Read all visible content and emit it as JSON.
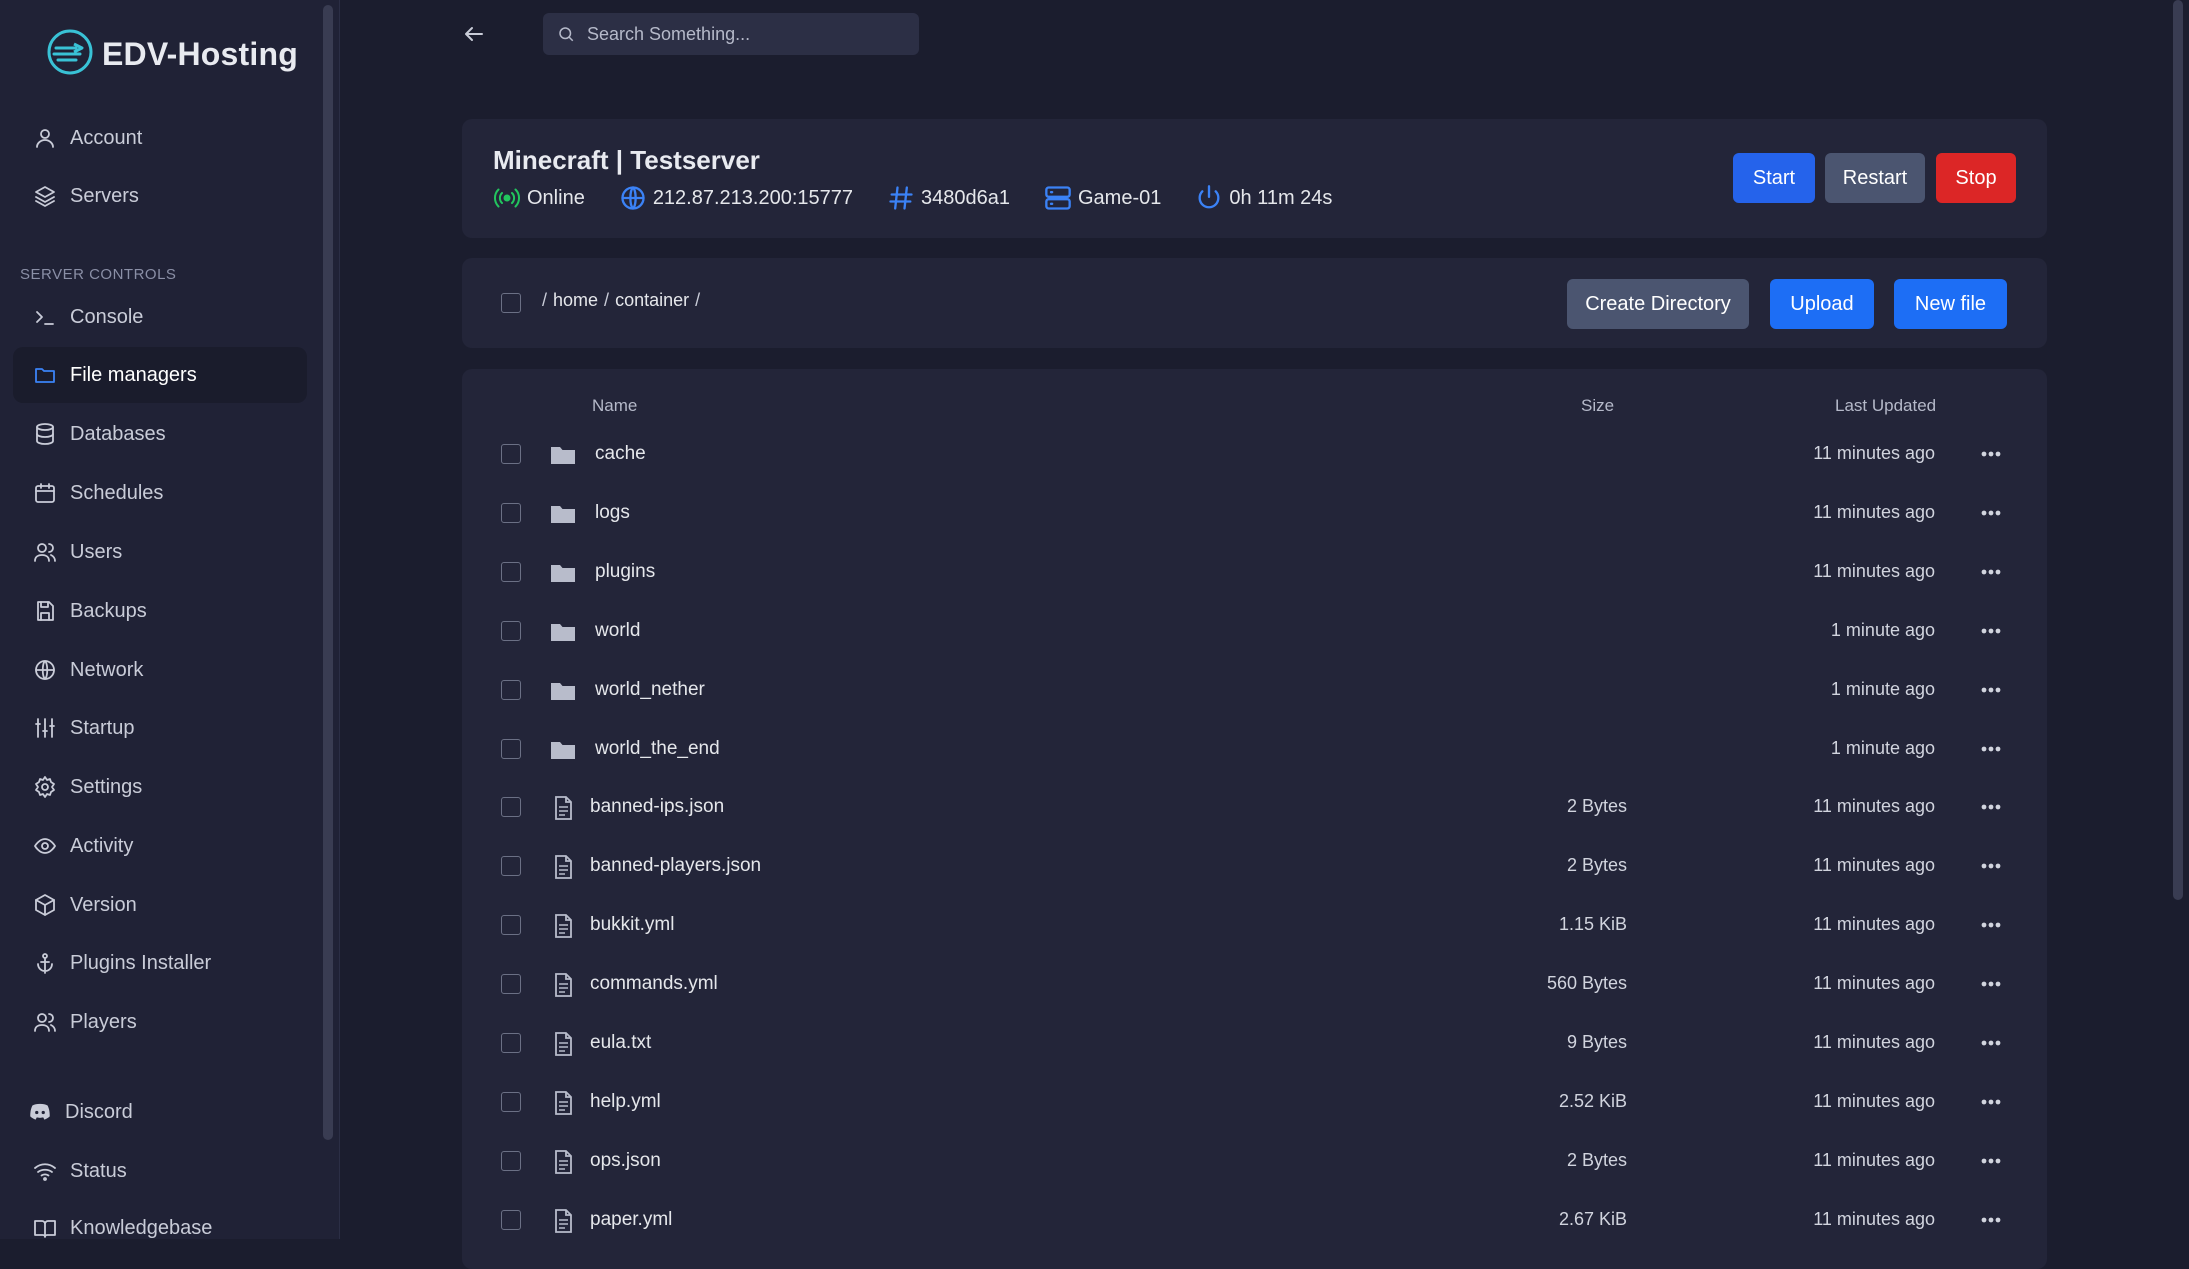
{
  "brand": {
    "name": "EDV-Hosting"
  },
  "sidebar": {
    "top_items": [
      {
        "label": "Account",
        "icon": "user-icon"
      },
      {
        "label": "Servers",
        "icon": "layers-icon"
      }
    ],
    "section_label": "SERVER CONTROLS",
    "controls": [
      {
        "label": "Console",
        "icon": "terminal-icon"
      },
      {
        "label": "File managers",
        "icon": "folder-icon",
        "active": true
      },
      {
        "label": "Databases",
        "icon": "database-icon"
      },
      {
        "label": "Schedules",
        "icon": "calendar-icon"
      },
      {
        "label": "Users",
        "icon": "users-icon"
      },
      {
        "label": "Backups",
        "icon": "save-icon"
      },
      {
        "label": "Network",
        "icon": "globe-icon"
      },
      {
        "label": "Startup",
        "icon": "sliders-icon"
      },
      {
        "label": "Settings",
        "icon": "gear-icon"
      },
      {
        "label": "Activity",
        "icon": "eye-icon"
      },
      {
        "label": "Version",
        "icon": "box-icon"
      },
      {
        "label": "Plugins Installer",
        "icon": "anchor-icon"
      },
      {
        "label": "Players",
        "icon": "users-icon"
      }
    ],
    "bottom_items": [
      {
        "label": "Discord",
        "icon": "discord-icon"
      },
      {
        "label": "Status",
        "icon": "wifi-icon"
      },
      {
        "label": "Knowledgebase",
        "icon": "book-icon"
      }
    ]
  },
  "search": {
    "placeholder": "Search Something..."
  },
  "server": {
    "title": "Minecraft | Testserver",
    "status": "Online",
    "address": "212.87.213.200:15777",
    "id": "3480d6a1",
    "node": "Game-01",
    "uptime": "0h 11m 24s",
    "buttons": {
      "start": "Start",
      "restart": "Restart",
      "stop": "Stop"
    }
  },
  "breadcrumb": {
    "root": "/",
    "segments": [
      "home",
      "container"
    ],
    "separator": "/"
  },
  "file_actions": {
    "create_directory": "Create Directory",
    "upload": "Upload",
    "new_file": "New file"
  },
  "table": {
    "headers": {
      "name": "Name",
      "size": "Size",
      "updated": "Last Updated"
    },
    "rows": [
      {
        "name": "cache",
        "type": "folder",
        "size": "",
        "updated": "11 minutes ago"
      },
      {
        "name": "logs",
        "type": "folder",
        "size": "",
        "updated": "11 minutes ago"
      },
      {
        "name": "plugins",
        "type": "folder",
        "size": "",
        "updated": "11 minutes ago"
      },
      {
        "name": "world",
        "type": "folder",
        "size": "",
        "updated": "1 minute ago"
      },
      {
        "name": "world_nether",
        "type": "folder",
        "size": "",
        "updated": "1 minute ago"
      },
      {
        "name": "world_the_end",
        "type": "folder",
        "size": "",
        "updated": "1 minute ago"
      },
      {
        "name": "banned-ips.json",
        "type": "file",
        "size": "2 Bytes",
        "updated": "11 minutes ago"
      },
      {
        "name": "banned-players.json",
        "type": "file",
        "size": "2 Bytes",
        "updated": "11 minutes ago"
      },
      {
        "name": "bukkit.yml",
        "type": "file",
        "size": "1.15 KiB",
        "updated": "11 minutes ago"
      },
      {
        "name": "commands.yml",
        "type": "file",
        "size": "560 Bytes",
        "updated": "11 minutes ago"
      },
      {
        "name": "eula.txt",
        "type": "file",
        "size": "9 Bytes",
        "updated": "11 minutes ago"
      },
      {
        "name": "help.yml",
        "type": "file",
        "size": "2.52 KiB",
        "updated": "11 minutes ago"
      },
      {
        "name": "ops.json",
        "type": "file",
        "size": "2 Bytes",
        "updated": "11 minutes ago"
      },
      {
        "name": "paper.yml",
        "type": "file",
        "size": "2.67 KiB",
        "updated": "11 minutes ago"
      }
    ]
  },
  "colors": {
    "accent": "#2563eb",
    "online": "#22c55e",
    "danger": "#dc2626",
    "background": "#1b1d2e",
    "card": "#232539"
  }
}
